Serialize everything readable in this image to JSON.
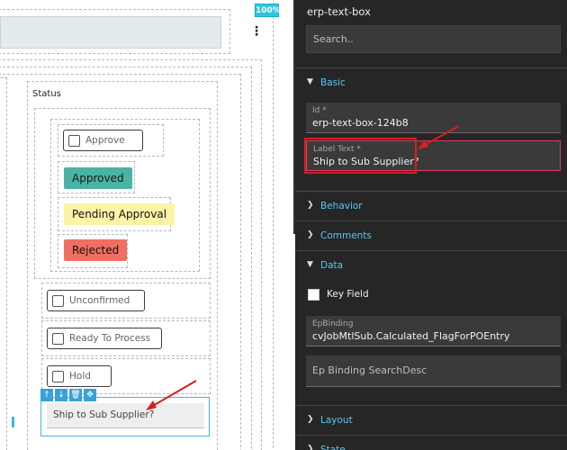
{
  "canvas": {
    "zoom": "100%",
    "status_title": "Status",
    "checkbox_approve": "Approve",
    "badges": {
      "approved": "Approved",
      "pending": "Pending Approval",
      "rejected": "Rejected"
    },
    "checkbox_unconfirmed": "Unconfirmed",
    "checkbox_ready": "Ready To Process",
    "checkbox_hold": "Hold",
    "selected_textbox_value": "Ship to Sub Supplier?",
    "toolbar_icons": [
      "arrow-up-icon",
      "arrow-down-icon",
      "trash-icon",
      "move-icon"
    ]
  },
  "panel": {
    "title": "erp-text-box",
    "search_placeholder": "Search..",
    "sections": {
      "basic": "Basic",
      "behavior": "Behavior",
      "comments": "Comments",
      "data": "Data",
      "layout": "Layout",
      "state": "State"
    },
    "id_field": {
      "label": "Id *",
      "value": "erp-text-box-124b8"
    },
    "label_text_field": {
      "label": "Label Text *",
      "value": "Ship to Sub Supplier?"
    },
    "key_field_label": "Key Field",
    "ep_binding": {
      "label": "EpBinding",
      "value": "cvJobMtlSub.Calculated_FlagForPOEntry"
    },
    "ep_binding_search_desc": "Ep Binding SearchDesc"
  },
  "colors": {
    "accent": "#5bc6f0",
    "approved": "#4ab3a3",
    "pending": "#fbf3a6",
    "rejected": "#f06e62",
    "annotation": "#d81e1e"
  }
}
